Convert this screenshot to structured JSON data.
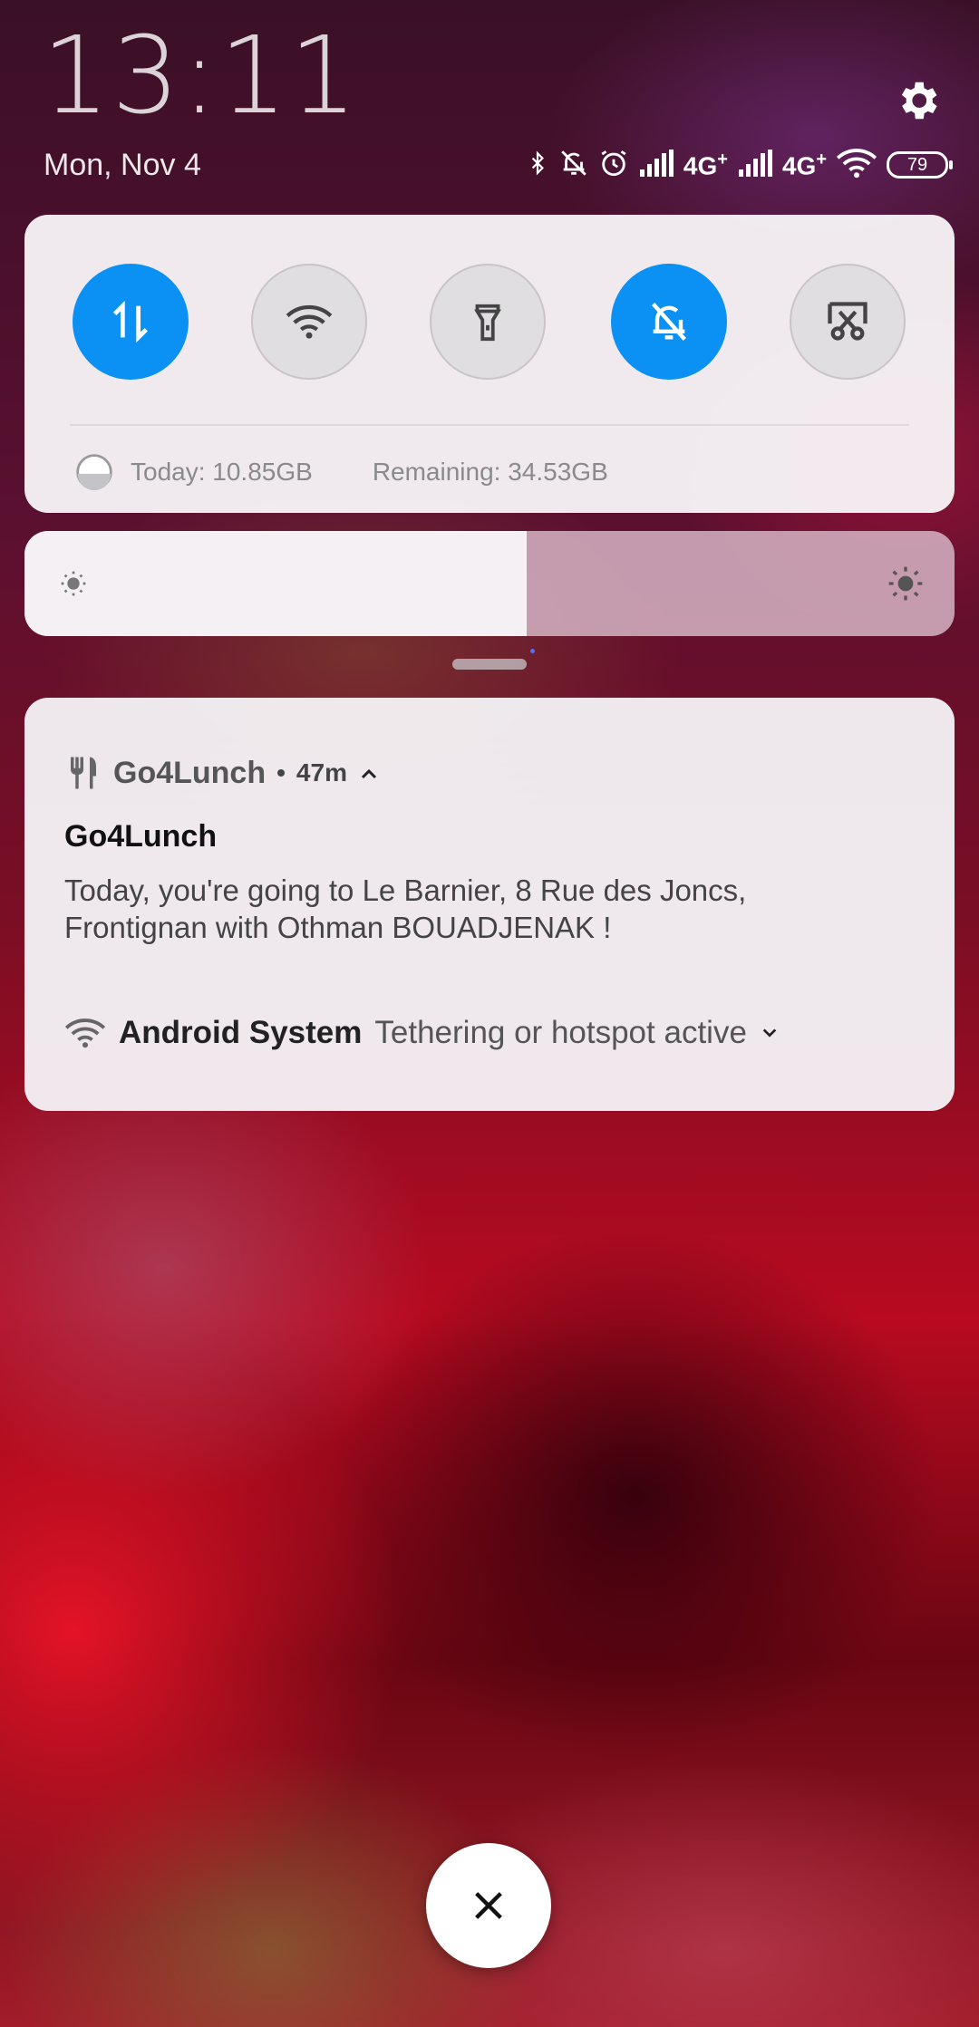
{
  "status_bar": {
    "time": "13:11",
    "date": "Mon, Nov 4",
    "network_1": "4G",
    "network_2": "4G",
    "plus": "+",
    "battery_level": "79"
  },
  "icons": {
    "settings": "gear-icon",
    "bluetooth": "bluetooth-icon",
    "dnd": "notifications-off-icon",
    "alarm": "alarm-icon",
    "signal": "signal-icon",
    "wifi": "wifi-icon",
    "battery": "battery-icon"
  },
  "quick_settings": {
    "tiles": [
      {
        "name": "mobile-data",
        "icon": "data-transfer-icon",
        "active": true
      },
      {
        "name": "wifi",
        "icon": "wifi-icon",
        "active": false
      },
      {
        "name": "flashlight",
        "icon": "flashlight-icon",
        "active": false
      },
      {
        "name": "silent",
        "icon": "bell-off-icon",
        "active": true
      },
      {
        "name": "screenshot",
        "icon": "scissors-icon",
        "active": false
      }
    ],
    "data_today": "Today: 10.85GB",
    "data_remaining": "Remaining: 34.53GB"
  },
  "brightness": {
    "level_percent": 54
  },
  "notifications": {
    "go4lunch": {
      "app_name": "Go4Lunch",
      "time_ago": "47m",
      "separator": "•",
      "title": "Go4Lunch",
      "body": "Today, you're going to Le Barnier, 8 Rue des Joncs, Frontignan with Othman BOUADJENAK !"
    },
    "system": {
      "app_name": "Android System",
      "text": "Tethering or hotspot active"
    }
  },
  "colors": {
    "accent": "#0a91f3",
    "panel": "#f7f4f7"
  }
}
